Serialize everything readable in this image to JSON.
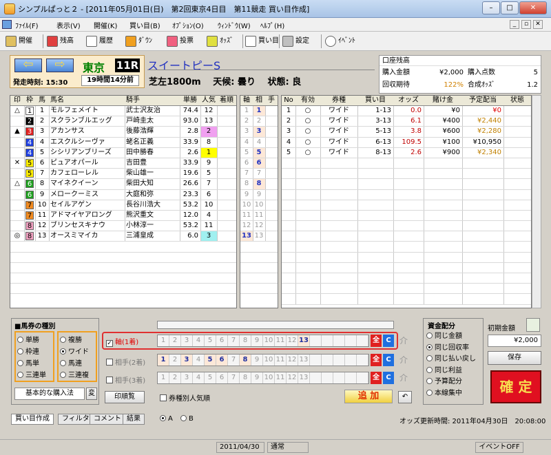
{
  "window": {
    "title": "シンプルぱっと２ - [2011年05月01日(日)　第2回東京4日目　第11競走 買い目作成]",
    "min": "–",
    "max": "□",
    "close": "✕",
    "mdi_min": "_",
    "mdi_restore": "▫",
    "mdi_close": "✕"
  },
  "menu": [
    "ﾌｧｲﾙ(F)",
    "表示(V)",
    "開催(K)",
    "買い目(B)",
    "ｵﾌﾟｼｮﾝ(O)",
    "ｳｨﾝﾄﾞｳ(W)",
    "ﾍﾙﾌﾟ(H)"
  ],
  "toolbar": [
    "開催",
    "残高",
    "履歴",
    "ﾀﾞｳﾝ",
    "投票",
    "ｵｯｽﾞ",
    "買い目",
    "設定",
    "ｲﾍﾞﾝﾄ"
  ],
  "race": {
    "prev": "⇦",
    "next": "⇨",
    "venue": "東京",
    "race_no": "11R",
    "start": "発走時刻: 15:30",
    "remaining": "19時間14分前",
    "name": "スイートピーS",
    "course": "芝左1800m",
    "weather": "天候: 曇り",
    "condition": "状態: 良"
  },
  "account": {
    "label_balance": "口座残高",
    "balance": "",
    "label_buy": "購入金額",
    "buy": "¥2,000",
    "label_points": "購入点数",
    "points": "5",
    "label_expect": "回収期待",
    "expect": "122%",
    "label_odds": "合成ｵｯｽﾞ",
    "odds": "1.2"
  },
  "horse_header": [
    "印",
    "枠",
    "馬",
    "馬名",
    "騎手",
    "単勝",
    "人気",
    "着順"
  ],
  "horses": [
    {
      "mark": "△",
      "waku": "1",
      "num": "1",
      "name": "モルフェメイト",
      "jockey": "武士沢友治",
      "odds": "74.4",
      "pop": "12",
      "wc": "#ffffff",
      "wt": "#000",
      "pc": ""
    },
    {
      "mark": "",
      "waku": "2",
      "num": "2",
      "name": "スクランブルエッグ",
      "jockey": "戸崎圭太",
      "odds": "93.0",
      "pop": "13",
      "wc": "#000000",
      "wt": "#fff",
      "pc": ""
    },
    {
      "mark": "▲",
      "waku": "3",
      "num": "3",
      "name": "アカンサス",
      "jockey": "後藤浩輝",
      "odds": "2.8",
      "pop": "2",
      "wc": "#e02020",
      "wt": "#fff",
      "pc": "#f0a0f0"
    },
    {
      "mark": "",
      "waku": "4",
      "num": "4",
      "name": "エスクルシーヴァ",
      "jockey": "蛯名正義",
      "odds": "33.9",
      "pop": "8",
      "wc": "#2040e0",
      "wt": "#fff",
      "pc": ""
    },
    {
      "mark": "",
      "waku": "4",
      "num": "5",
      "name": "シシリアンブリーズ",
      "jockey": "田中勝春",
      "odds": "2.6",
      "pop": "1",
      "wc": "#2040e0",
      "wt": "#fff",
      "pc": "#ffff00"
    },
    {
      "mark": "✕",
      "waku": "5",
      "num": "6",
      "name": "ピュアオパール",
      "jockey": "吉田豊",
      "odds": "33.9",
      "pop": "9",
      "wc": "#ffee00",
      "wt": "#000",
      "pc": ""
    },
    {
      "mark": "",
      "waku": "5",
      "num": "7",
      "name": "カフェローレル",
      "jockey": "柴山雄一",
      "odds": "19.6",
      "pop": "5",
      "wc": "#ffee00",
      "wt": "#000",
      "pc": ""
    },
    {
      "mark": "△",
      "waku": "6",
      "num": "8",
      "name": "マイネクイーン",
      "jockey": "柴田大知",
      "odds": "26.6",
      "pop": "7",
      "wc": "#20a020",
      "wt": "#fff",
      "pc": ""
    },
    {
      "mark": "",
      "waku": "6",
      "num": "9",
      "name": "メロークーミス",
      "jockey": "大庭和弥",
      "odds": "23.3",
      "pop": "6",
      "wc": "#20a020",
      "wt": "#fff",
      "pc": ""
    },
    {
      "mark": "",
      "waku": "7",
      "num": "10",
      "name": "セイルアゲン",
      "jockey": "長谷川浩大",
      "odds": "53.2",
      "pop": "10",
      "wc": "#f08a20",
      "wt": "#000",
      "pc": ""
    },
    {
      "mark": "",
      "waku": "7",
      "num": "11",
      "name": "アドマイヤアロング",
      "jockey": "熊沢重文",
      "odds": "12.0",
      "pop": "4",
      "wc": "#f08a20",
      "wt": "#000",
      "pc": ""
    },
    {
      "mark": "",
      "waku": "8",
      "num": "12",
      "name": "ブリンセスキナウ",
      "jockey": "小林淳一",
      "odds": "53.2",
      "pop": "11",
      "wc": "#f0a0c0",
      "wt": "#000",
      "pc": ""
    },
    {
      "mark": "◎",
      "waku": "8",
      "num": "13",
      "name": "オースミマイカ",
      "jockey": "三浦皇成",
      "odds": "6.0",
      "pop": "3",
      "wc": "#f0a0c0",
      "wt": "#000",
      "pc": "#a0f0f0"
    }
  ],
  "jiku_header": [
    "軸",
    "相",
    "手"
  ],
  "jiku": [
    {
      "a": "1",
      "b": "1"
    },
    {
      "a": "2",
      "b": "2"
    },
    {
      "a": "3",
      "b": "3"
    },
    {
      "a": "4",
      "b": "4"
    },
    {
      "a": "5",
      "b": "5"
    },
    {
      "a": "6",
      "b": "6"
    },
    {
      "a": "7",
      "b": "7"
    },
    {
      "a": "8",
      "b": "8"
    },
    {
      "a": "9",
      "b": "9"
    },
    {
      "a": "10",
      "b": "10"
    },
    {
      "a": "11",
      "b": "11"
    },
    {
      "a": "12",
      "b": "12"
    },
    {
      "a": "13",
      "b": "13"
    }
  ],
  "bet_header": [
    "No",
    "有効",
    "券種",
    "買い目",
    "オッズ",
    "賭け金",
    "予定配当",
    "状態"
  ],
  "bets": [
    {
      "no": "1",
      "on": "○",
      "type": "ワイド",
      "combo": "1-13",
      "odds": "0.0",
      "stake": "¥0",
      "payout": "¥0",
      "pcolor": "#e00000"
    },
    {
      "no": "2",
      "on": "○",
      "type": "ワイド",
      "combo": "3-13",
      "odds": "6.1",
      "stake": "¥400",
      "payout": "¥2,440",
      "pcolor": "#c08000"
    },
    {
      "no": "3",
      "on": "○",
      "type": "ワイド",
      "combo": "5-13",
      "odds": "3.8",
      "stake": "¥600",
      "payout": "¥2,280",
      "pcolor": "#c08000"
    },
    {
      "no": "4",
      "on": "○",
      "type": "ワイド",
      "combo": "6-13",
      "odds": "109.5",
      "stake": "¥100",
      "payout": "¥10,950",
      "pcolor": "#000"
    },
    {
      "no": "5",
      "on": "○",
      "type": "ワイド",
      "combo": "8-13",
      "odds": "2.6",
      "stake": "¥900",
      "payout": "¥2,340",
      "pcolor": "#c08000"
    }
  ],
  "bettype": {
    "title": "■馬券の種別",
    "left": [
      "単勝",
      "枠連",
      "馬単",
      "三連単"
    ],
    "right": [
      "複勝",
      "ワイド",
      "馬連",
      "三連複"
    ],
    "selected": "ワイド"
  },
  "method": {
    "label": "基本的な購入法",
    "change": "変"
  },
  "print_list": "印順覧",
  "axis": {
    "jiku_label": "軸(1着)",
    "aite2_label": "相手(2着)",
    "aite3_label": "相手(3着)",
    "all": "全",
    "clear": "C",
    "kanji": "介"
  },
  "nums": [
    "1",
    "2",
    "3",
    "4",
    "5",
    "6",
    "7",
    "8",
    "9",
    "10",
    "11",
    "12",
    "13"
  ],
  "popularity_check": "券種別人気順",
  "add_button": "追 加",
  "undo": "↶",
  "alloc": {
    "title": "資金配分",
    "options": [
      "同じ金額",
      "同じ回収率",
      "同じ払い戻し",
      "同じ利益",
      "予算配分",
      "本線集中"
    ],
    "selected": "同じ回収率"
  },
  "initial_amount": {
    "label": "初期金額",
    "value": "¥2,000",
    "save": "保存"
  },
  "confirm": "確 定",
  "tabs": [
    "買い目作成",
    "フィルタ",
    "コメント",
    "結果"
  ],
  "ab": {
    "a": "A",
    "b": "B"
  },
  "odds_update": "オッズ更新時間: 2011年04月30日　20:08:00",
  "status": {
    "date": "2011/04/30",
    "mode": "通常",
    "event": "イベントOFF"
  }
}
